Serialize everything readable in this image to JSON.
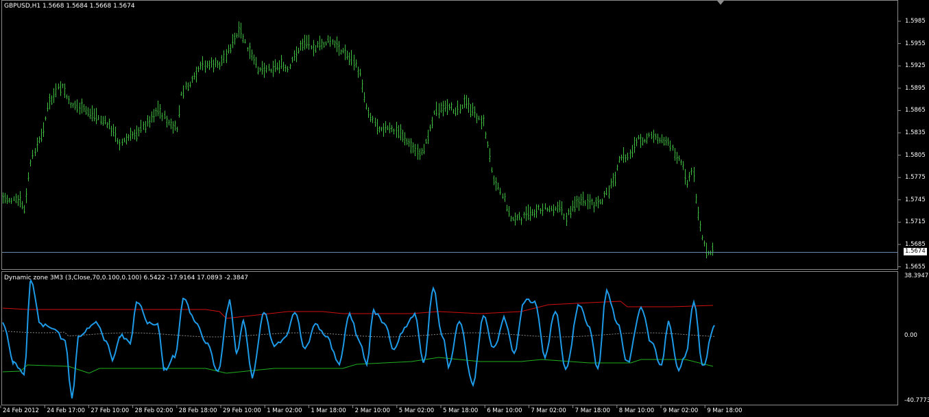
{
  "main_chart": {
    "symbol_line": "GBPUSD,H1  1.5668 1.5684 1.5668 1.5674",
    "current_price": "1.5674",
    "price_axis": [
      "1.5985",
      "1.5955",
      "1.5925",
      "1.5895",
      "1.5865",
      "1.5835",
      "1.5805",
      "1.5775",
      "1.5745",
      "1.5715",
      "1.5685",
      "1.5655"
    ],
    "bar_color": "#3fbf3f",
    "price_line_color": "#6a8cb0"
  },
  "indicator": {
    "title": "Dynamic zone 3M3 (3,Close,70,0.100,0.100) 6.5422 -17.9164 17.0893 -2.3847",
    "axis": [
      "38.3947",
      "0.00",
      "-40.7773"
    ],
    "colors": {
      "main": "#1e9be8",
      "upper": "#d01010",
      "lower": "#20b020",
      "middle": "#8a8a8a"
    }
  },
  "time_axis": [
    "24 Feb 2012",
    "24 Feb 17:00",
    "27 Feb 10:00",
    "28 Feb 02:00",
    "28 Feb 18:00",
    "29 Feb 10:00",
    "1 Mar 02:00",
    "1 Mar 18:00",
    "2 Mar 10:00",
    "5 Mar 02:00",
    "5 Mar 18:00",
    "6 Mar 10:00",
    "7 Mar 02:00",
    "7 Mar 18:00",
    "8 Mar 10:00",
    "9 Mar 02:00",
    "9 Mar 18:00"
  ]
}
